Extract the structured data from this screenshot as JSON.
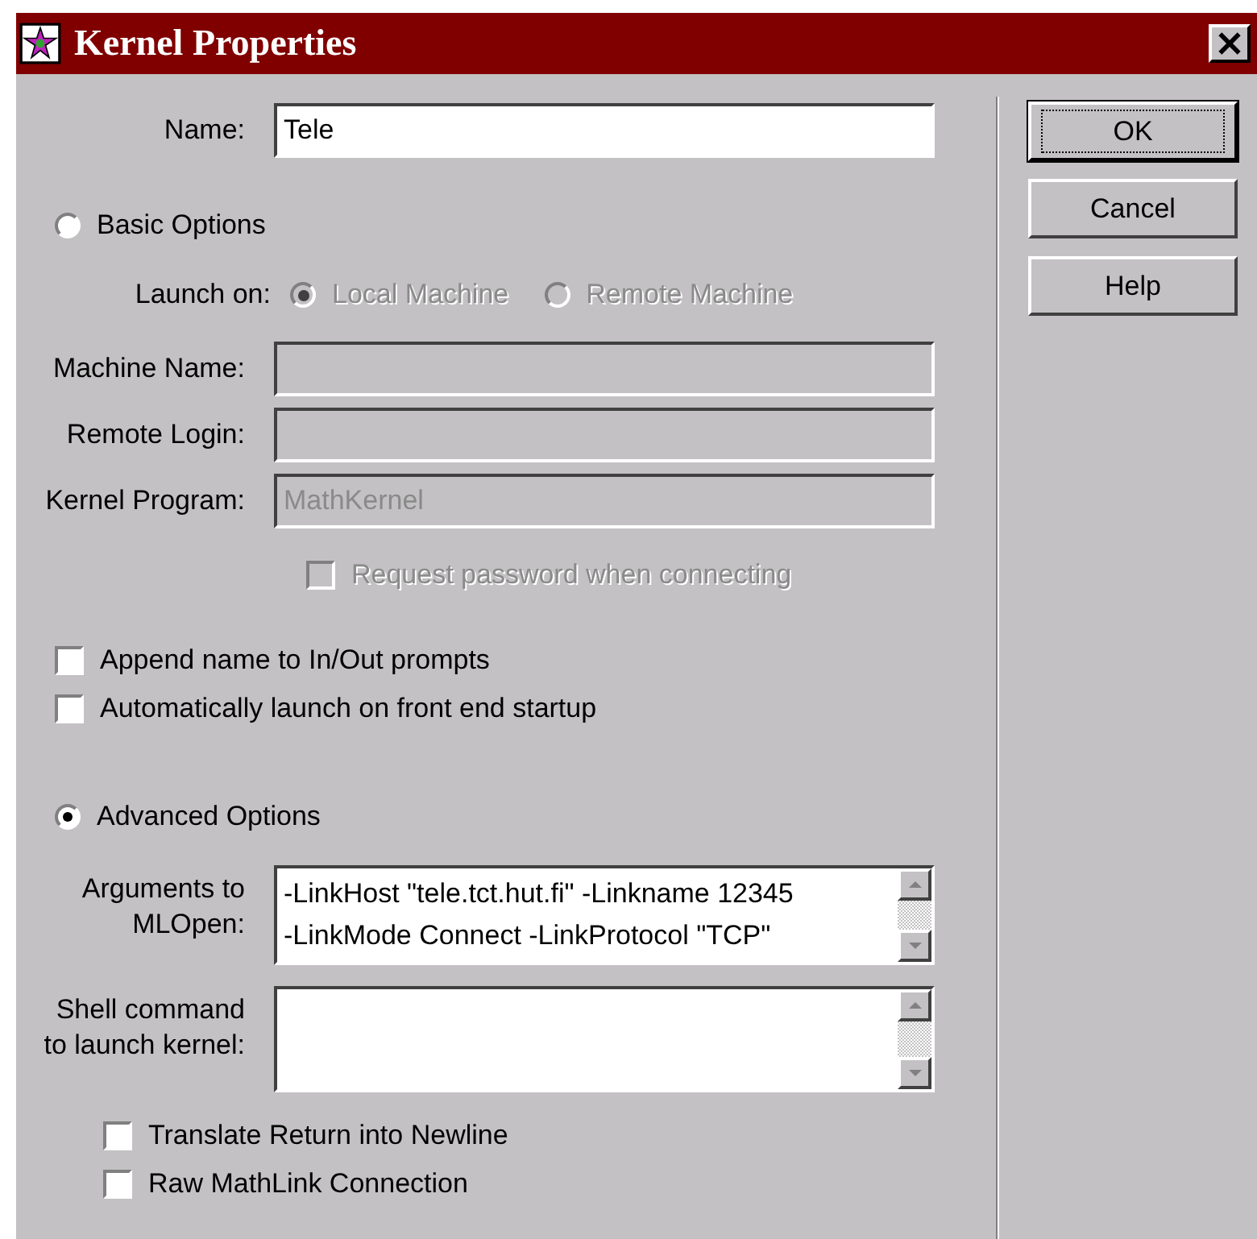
{
  "window": {
    "title": "Kernel Properties"
  },
  "name_field": {
    "label": "Name:",
    "value": "Tele"
  },
  "basic_options": {
    "label": "Basic Options",
    "selected": false
  },
  "launch_on": {
    "label": "Launch on:",
    "options": [
      {
        "label": "Local Machine",
        "selected": true,
        "disabled": true
      },
      {
        "label": "Remote Machine",
        "selected": false,
        "disabled": true
      }
    ]
  },
  "fields": [
    {
      "label": "Machine Name:",
      "disabled": true
    },
    {
      "label": "Remote Login:",
      "disabled": true
    },
    {
      "label": "Kernel Program:",
      "value": "MathKernel",
      "disabled": true
    }
  ],
  "request_password": {
    "label": "Request password when connecting",
    "checked": false,
    "disabled": true
  },
  "prompt_options": [
    {
      "label": "Append name to In/Out prompts",
      "checked": false
    },
    {
      "label": "Automatically launch on front end startup",
      "checked": false
    }
  ],
  "advanced_options": {
    "label": "Advanced Options",
    "selected": true
  },
  "arguments": {
    "label": "Arguments to MLOpen:",
    "lines": [
      "-LinkHost \"tele.tct.hut.fi\" -Linkname 12345",
      "-LinkMode Connect -LinkProtocol \"TCP\""
    ]
  },
  "shell_command": {
    "label": "Shell command to launch kernel:"
  },
  "link_options": [
    {
      "label": "Translate Return into Newline",
      "checked": false
    },
    {
      "label": "Raw MathLink Connection",
      "checked": false
    }
  ],
  "buttons": [
    {
      "label": "OK",
      "default": true
    },
    {
      "label": "Cancel",
      "default": false
    },
    {
      "label": "Help",
      "default": false
    }
  ]
}
